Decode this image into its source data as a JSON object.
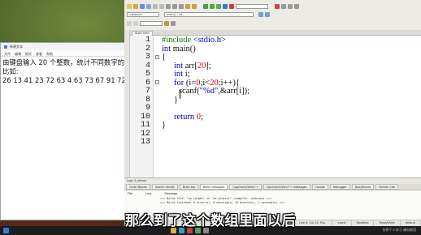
{
  "notepad": {
    "title": "新建文本",
    "menu": [
      "文件",
      "编辑",
      "格式",
      "查看",
      "帮助"
    ],
    "lines": [
      "由键盘输入 20 个整数，统计不同数字的",
      "比如:",
      "26 13 41 23 72 63 4 63 73 67 91 72 7"
    ]
  },
  "ide": {
    "scope_combo": "<global>",
    "function_combo": "main() : int",
    "editor_tab": "Start here",
    "code": {
      "line_numbers": [
        "1",
        "2",
        "3",
        "4",
        "5",
        "6",
        "7",
        "8",
        "9",
        "10",
        "11",
        "12",
        "13"
      ],
      "l1_pre": "#include ",
      "l1_hdr": "<stdio.h>",
      "l2_kw": "int",
      "l2_rest": " main()",
      "l3": "{",
      "l4_kw": "int",
      "l4_rest": " arr[",
      "l4_num": "20",
      "l4_end": "];",
      "l5_kw": "int",
      "l5_rest": " i;",
      "l6_kw": "for",
      "l6_a": " (i=",
      "l6_n1": "0",
      "l6_b": ";i<",
      "l6_n2": "20",
      "l6_c": ";i++){",
      "l7_a": "scanf(",
      "l7_str": "\"%d\"",
      "l7_b": ",&arr[i]);",
      "l8": "}",
      "l10_kw": "return",
      "l10_num": "0",
      "l10_end": ";",
      "l11": "}"
    },
    "logs": {
      "title": "Logs & others",
      "tabs": [
        "Code::Blocks",
        "Search results",
        "Build log",
        "Build messages",
        "CppCheck/Vera++",
        "CppCheck/Vera++ messages",
        "Cscope",
        "Debugger",
        "DoxyBlocks",
        "Fortran info"
      ],
      "col_file": "File",
      "col_line": "Line",
      "col_message": "Message",
      "line1": "=== Build file: \"no target\" in \"no project\" (compiler: unknown) ===",
      "line2": "=== Build finished: 0 error(s), 0 warning(s) (0 minute(s), 1 second(s)) ==="
    },
    "status": [
      "Windows (CR+LF)",
      "WINDOWS-936",
      "Line 8, Col 10, Pos 98",
      "Insert",
      "Modified",
      "Read/Write",
      "default"
    ]
  },
  "subtitle": "那么到了这个数组里面以后",
  "watermark": "仅供个人学习 请勿商用"
}
